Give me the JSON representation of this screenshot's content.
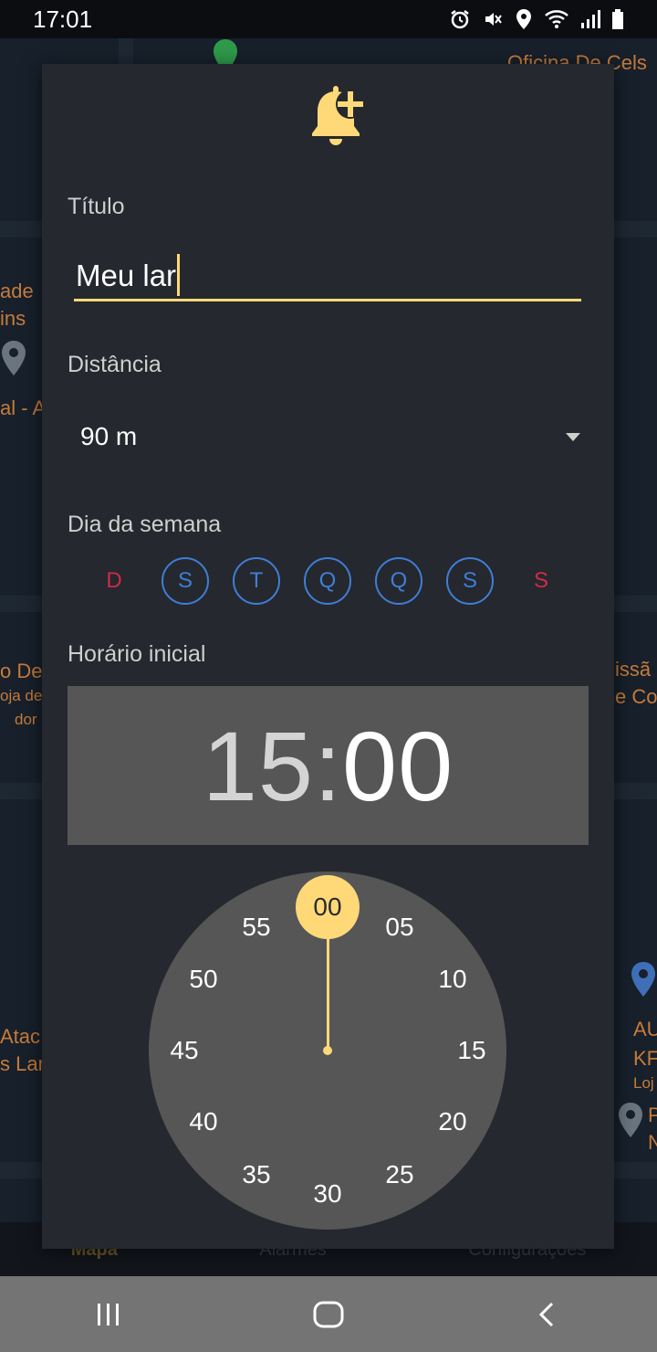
{
  "status_bar": {
    "time": "17:01"
  },
  "map": {
    "labels": [
      "Oficina De Cels",
      "ade",
      "ins",
      "al - A",
      "o De",
      "oja de",
      "dor",
      "issã",
      "e Cor",
      "Atac",
      "s Lar",
      "AU",
      "KF",
      "Loj",
      "P",
      "N"
    ]
  },
  "bottom_nav": {
    "items": [
      "Mapa",
      "Alarmes",
      "Configurações"
    ]
  },
  "dialog": {
    "title_label": "Título",
    "title_value": "Meu lar",
    "distance_label": "Distância",
    "distance_value": "90 m",
    "weekday_label": "Dia da semana",
    "weekdays": [
      "D",
      "S",
      "T",
      "Q",
      "Q",
      "S",
      "S"
    ],
    "start_time_label": "Horário inicial",
    "time": {
      "hours": "15",
      "separator": ":",
      "minutes": "00"
    },
    "clock": {
      "selected": "00",
      "numbers": [
        "05",
        "10",
        "15",
        "20",
        "25",
        "30",
        "35",
        "40",
        "45",
        "50",
        "55"
      ]
    }
  },
  "colors": {
    "accent": "#ffd978",
    "weekday_on": "#3f7ed6",
    "weekend": "#d02a48"
  }
}
